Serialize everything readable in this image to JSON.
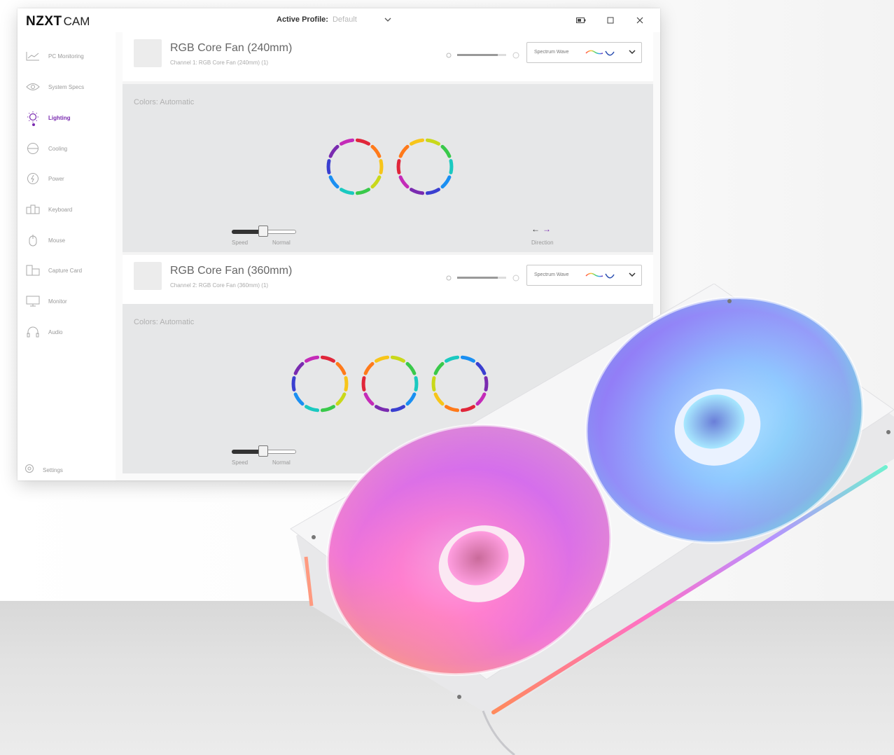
{
  "app": {
    "brand": "NZXT",
    "product": "CAM",
    "active_profile_label": "Active Profile:",
    "active_profile_value": "Default"
  },
  "sidebar": {
    "items": [
      {
        "label": "PC Monitoring",
        "icon": "line-chart-icon"
      },
      {
        "label": "System Specs",
        "icon": "eye-icon"
      },
      {
        "label": "Lighting",
        "icon": "bulb-icon",
        "active": true
      },
      {
        "label": "Cooling",
        "icon": "fan-icon"
      },
      {
        "label": "Power",
        "icon": "power-plug-icon"
      },
      {
        "label": "Keyboard",
        "icon": "keyboard-icon"
      },
      {
        "label": "Mouse",
        "icon": "mouse-icon"
      },
      {
        "label": "Capture Card",
        "icon": "capture-card-icon"
      },
      {
        "label": "Monitor",
        "icon": "monitor-icon"
      },
      {
        "label": "Audio",
        "icon": "headset-icon"
      }
    ],
    "settings_label": "Settings"
  },
  "devices": [
    {
      "title": "RGB Core Fan (240mm)",
      "channel": "Channel 1: RGB Core Fan (240mm) (1)",
      "effect": "Spectrum Wave",
      "colors_label": "Colors: Automatic",
      "fan_count": 2,
      "speed_label": "Speed",
      "speed_value": "Normal",
      "direction_label": "Direction"
    },
    {
      "title": "RGB Core Fan (360mm)",
      "channel": "Channel 2: RGB Core Fan (360mm) (1)",
      "effect": "Spectrum Wave",
      "colors_label": "Colors: Automatic",
      "fan_count": 3,
      "speed_label": "Speed",
      "speed_value": "Normal"
    }
  ],
  "colors": {
    "accent": "#7a2bb0",
    "panel": "#e6e7e8"
  }
}
